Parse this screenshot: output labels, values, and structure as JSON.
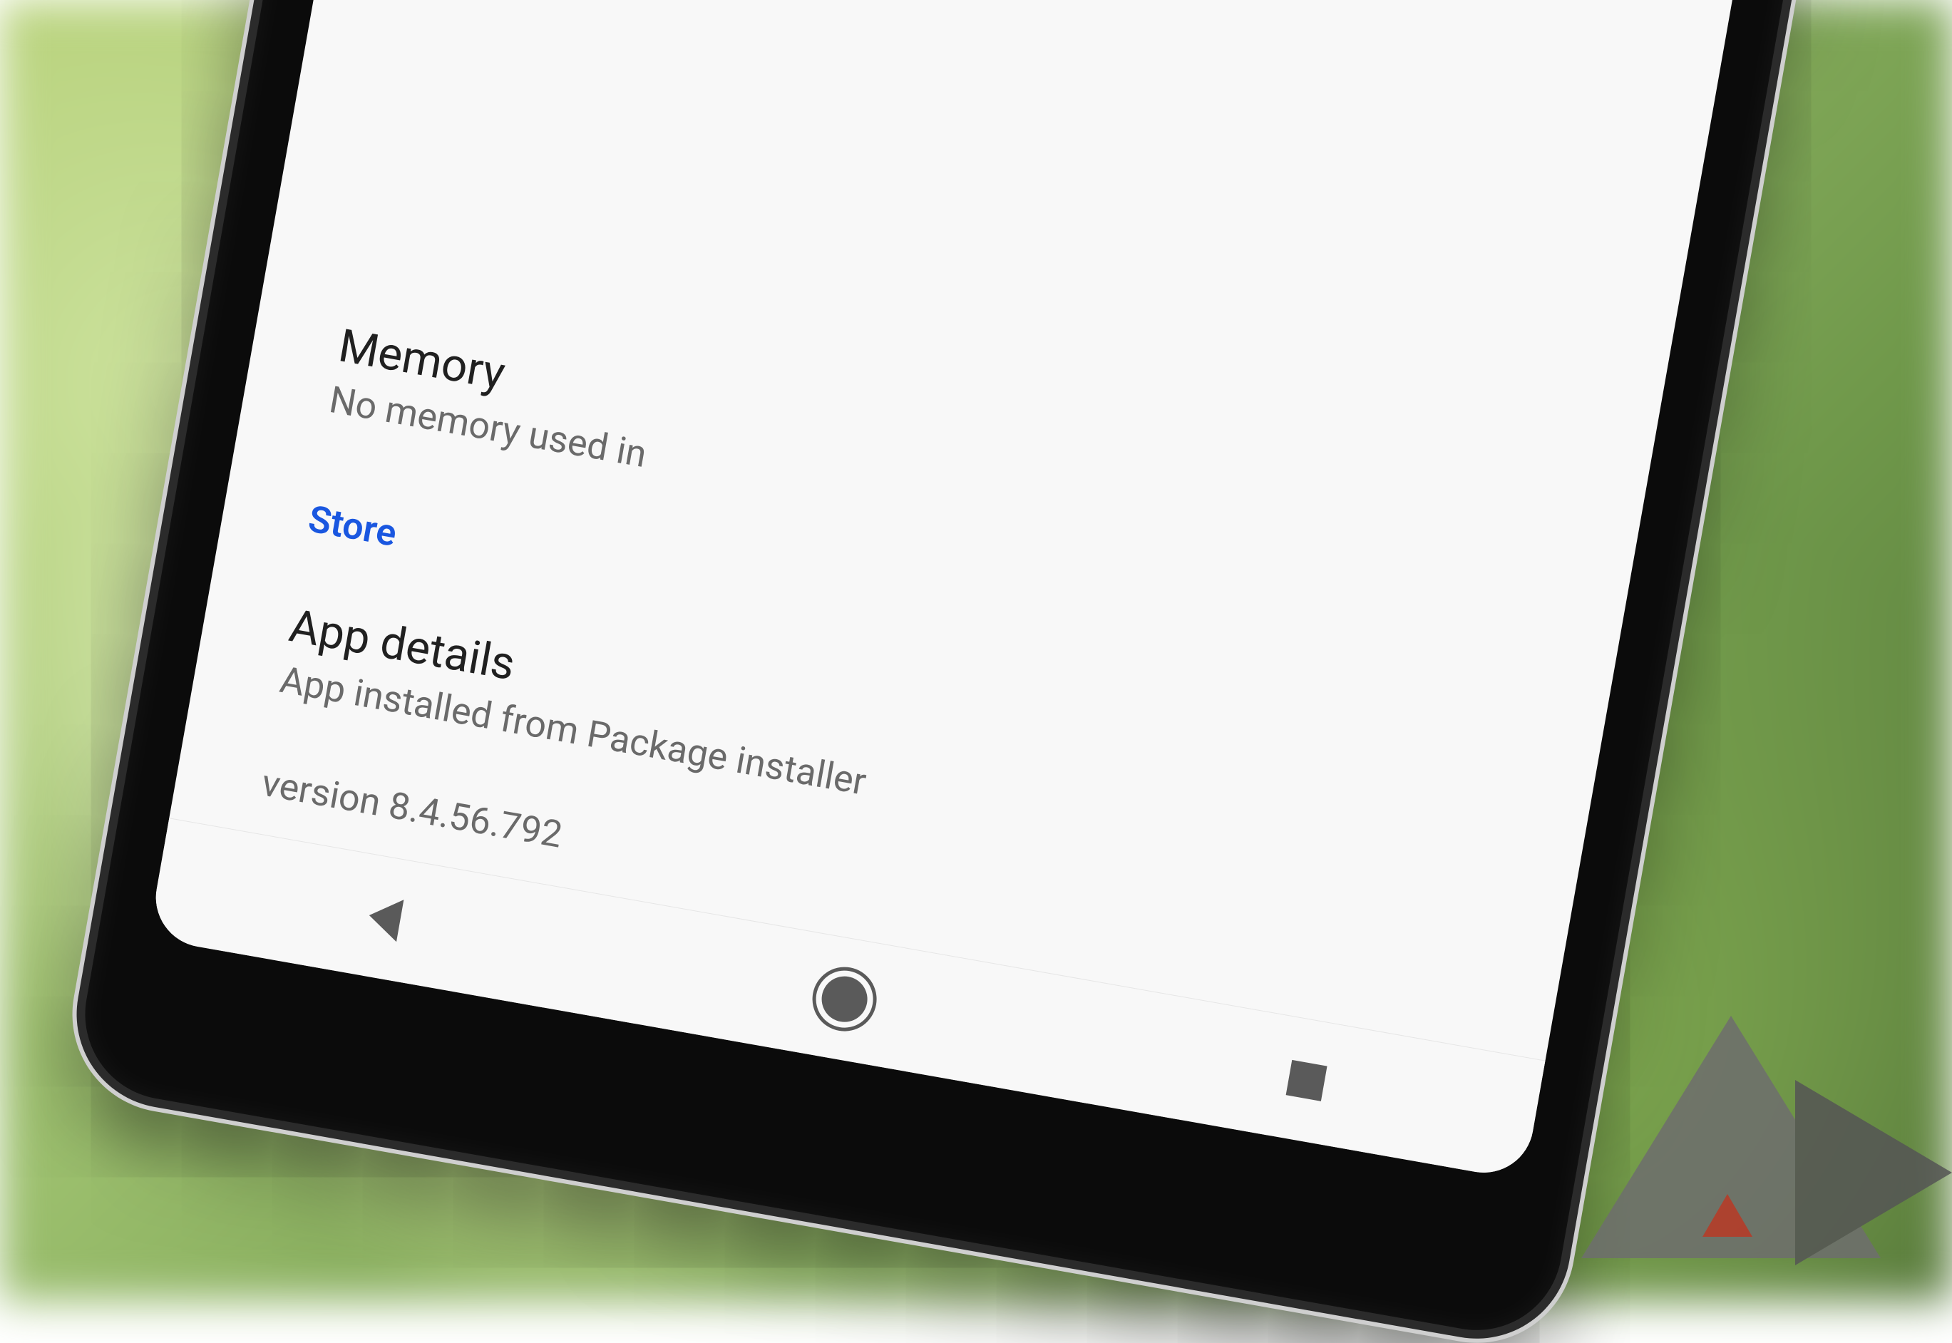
{
  "memory_row": {
    "title": "Memory",
    "sub": "No memory used in"
  },
  "store_section": {
    "header": "Store",
    "app_details": {
      "title": "App details",
      "sub": "App installed from Package installer"
    }
  },
  "version_text": "version 8.4.56.792"
}
